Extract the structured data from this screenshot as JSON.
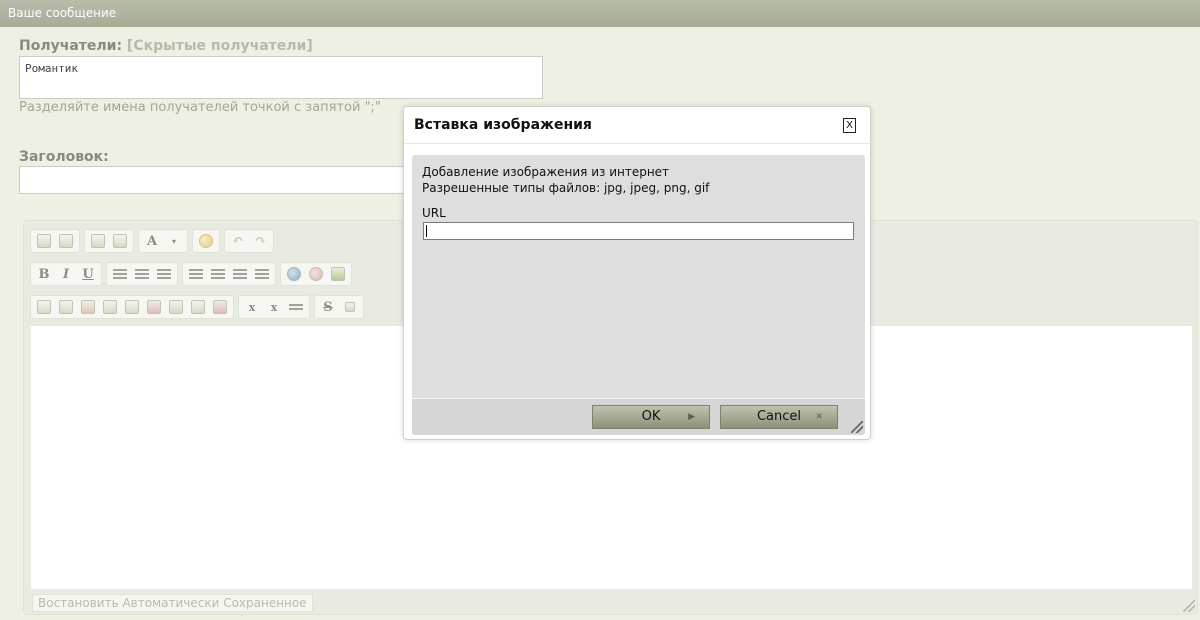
{
  "header": {
    "title": "Ваше сообщение"
  },
  "recipients": {
    "label": "Получатели:",
    "hidden_link": "[Скрытые получатели]",
    "value": "Романтик",
    "hint": "Разделяйте имена получателей точкой с запятой \";\""
  },
  "subject": {
    "label": "Заголовок:"
  },
  "editor": {
    "restore_label": "Востановить Автоматически Сохраненное",
    "toolbar_glyphs": {
      "bold": "B",
      "italic": "I",
      "underline": "U",
      "font": "A",
      "strike": "S",
      "sub": "x",
      "sup": "x"
    }
  },
  "dialog": {
    "title": "Вставка изображения",
    "close": "X",
    "line1": "Добавление изображения из интернет",
    "line2": "Разрешенные типы файлов: jpg, jpeg, png, gif",
    "url_label": "URL",
    "ok": "OK",
    "cancel": "Cancel",
    "ok_arrow": "▶",
    "cancel_mark": "✕"
  },
  "colors": {
    "header_bg": "#aeb39e",
    "page_bg": "#eef0e3",
    "button_bg": "#a3a78f"
  }
}
